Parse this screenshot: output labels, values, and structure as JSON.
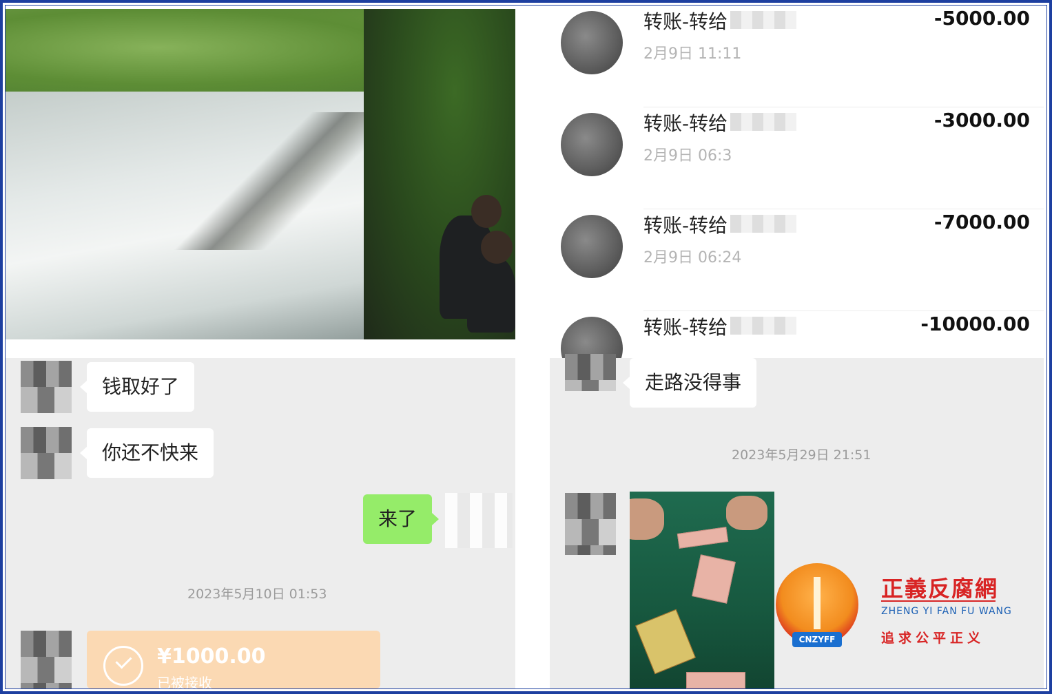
{
  "transactions": [
    {
      "title": "转账-转给",
      "time": "2月9日 11:11",
      "amount": "-5000.00"
    },
    {
      "title": "转账-转给",
      "time": "2月9日 06:3",
      "amount": "-3000.00"
    },
    {
      "title": "转账-转给",
      "time": "2月9日 06:24",
      "amount": "-7000.00"
    },
    {
      "title": "转账-转给",
      "time": "",
      "amount": "-10000.00"
    }
  ],
  "chat_left": {
    "messages": [
      {
        "text": "钱取好了"
      },
      {
        "text": "你还不快来"
      },
      {
        "text": "来了"
      }
    ],
    "timestamp": "2023年5月10日 01:53",
    "transfer": {
      "amount": "¥1000.00",
      "status": "已被接收"
    }
  },
  "chat_right": {
    "message": "走路没得事",
    "timestamp": "2023年5月29日 21:51"
  },
  "watermark": {
    "name_cn": "正義反腐網",
    "name_en": "ZHENG YI FAN FU WANG",
    "slogan": "追求公平正义",
    "badge": "CNZYFF"
  }
}
